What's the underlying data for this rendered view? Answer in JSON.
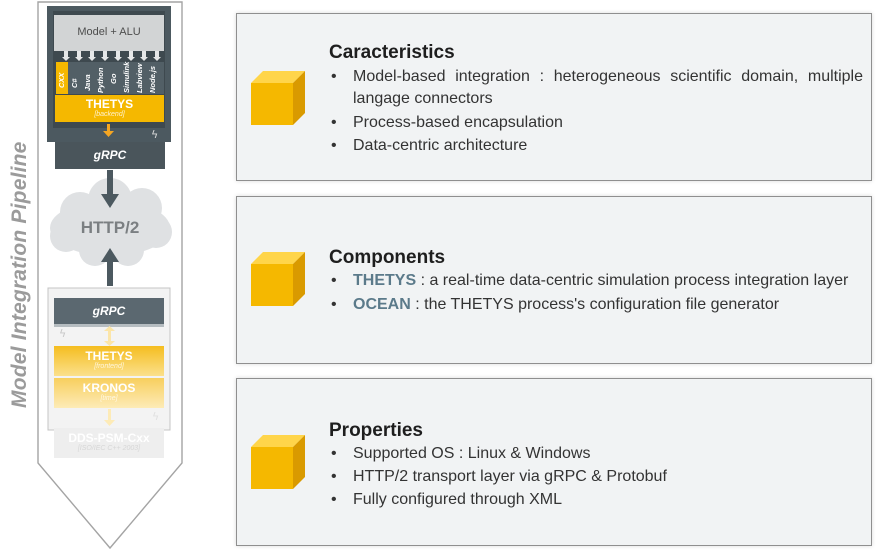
{
  "pipeline": {
    "title": "Model Integration Pipeline",
    "top": {
      "model_box": "Model + ALU",
      "connectors": [
        "CXX",
        "C#",
        "Java",
        "Python",
        "Go",
        "Simulink",
        "Labview",
        "Node.js"
      ],
      "thetys_label": "THETYS",
      "thetys_sub": "[backend]",
      "grpc_label": "gRPC"
    },
    "cloud_label": "HTTP/2",
    "bottom": {
      "grpc_label": "gRPC",
      "thetys_label": "THETYS",
      "thetys_sub": "[frontend]",
      "kronos_label": "KRONOS",
      "kronos_sub": "[time]",
      "dds_label": "DDS-PSM-Cxx",
      "dds_sub": "[ISO/IEC C++ 2003]"
    }
  },
  "panels": [
    {
      "title": "Caracteristics",
      "items": [
        {
          "text": "Model-based integration : heterogeneous scientific domain, multiple langage connectors"
        },
        {
          "text": "Process-based encapsulation"
        },
        {
          "text": "Data-centric architecture"
        }
      ]
    },
    {
      "title": "Components",
      "items": [
        {
          "keyword": "THETYS",
          "text": " : a real-time data-centric simulation process integration layer"
        },
        {
          "keyword": "OCEAN",
          "text": " : the THETYS process's configuration file generator"
        }
      ]
    },
    {
      "title": "Properties",
      "items": [
        {
          "text": "Supported OS : Linux & Windows"
        },
        {
          "text": "HTTP/2 transport layer via gRPC & Protobuf"
        },
        {
          "text": "Fully configured through XML"
        }
      ]
    }
  ],
  "colors": {
    "accent_yellow": "#f5b800",
    "slate": "#4c5960",
    "panel_bg": "#f1f3f4",
    "keyword": "#5b7a8a"
  }
}
